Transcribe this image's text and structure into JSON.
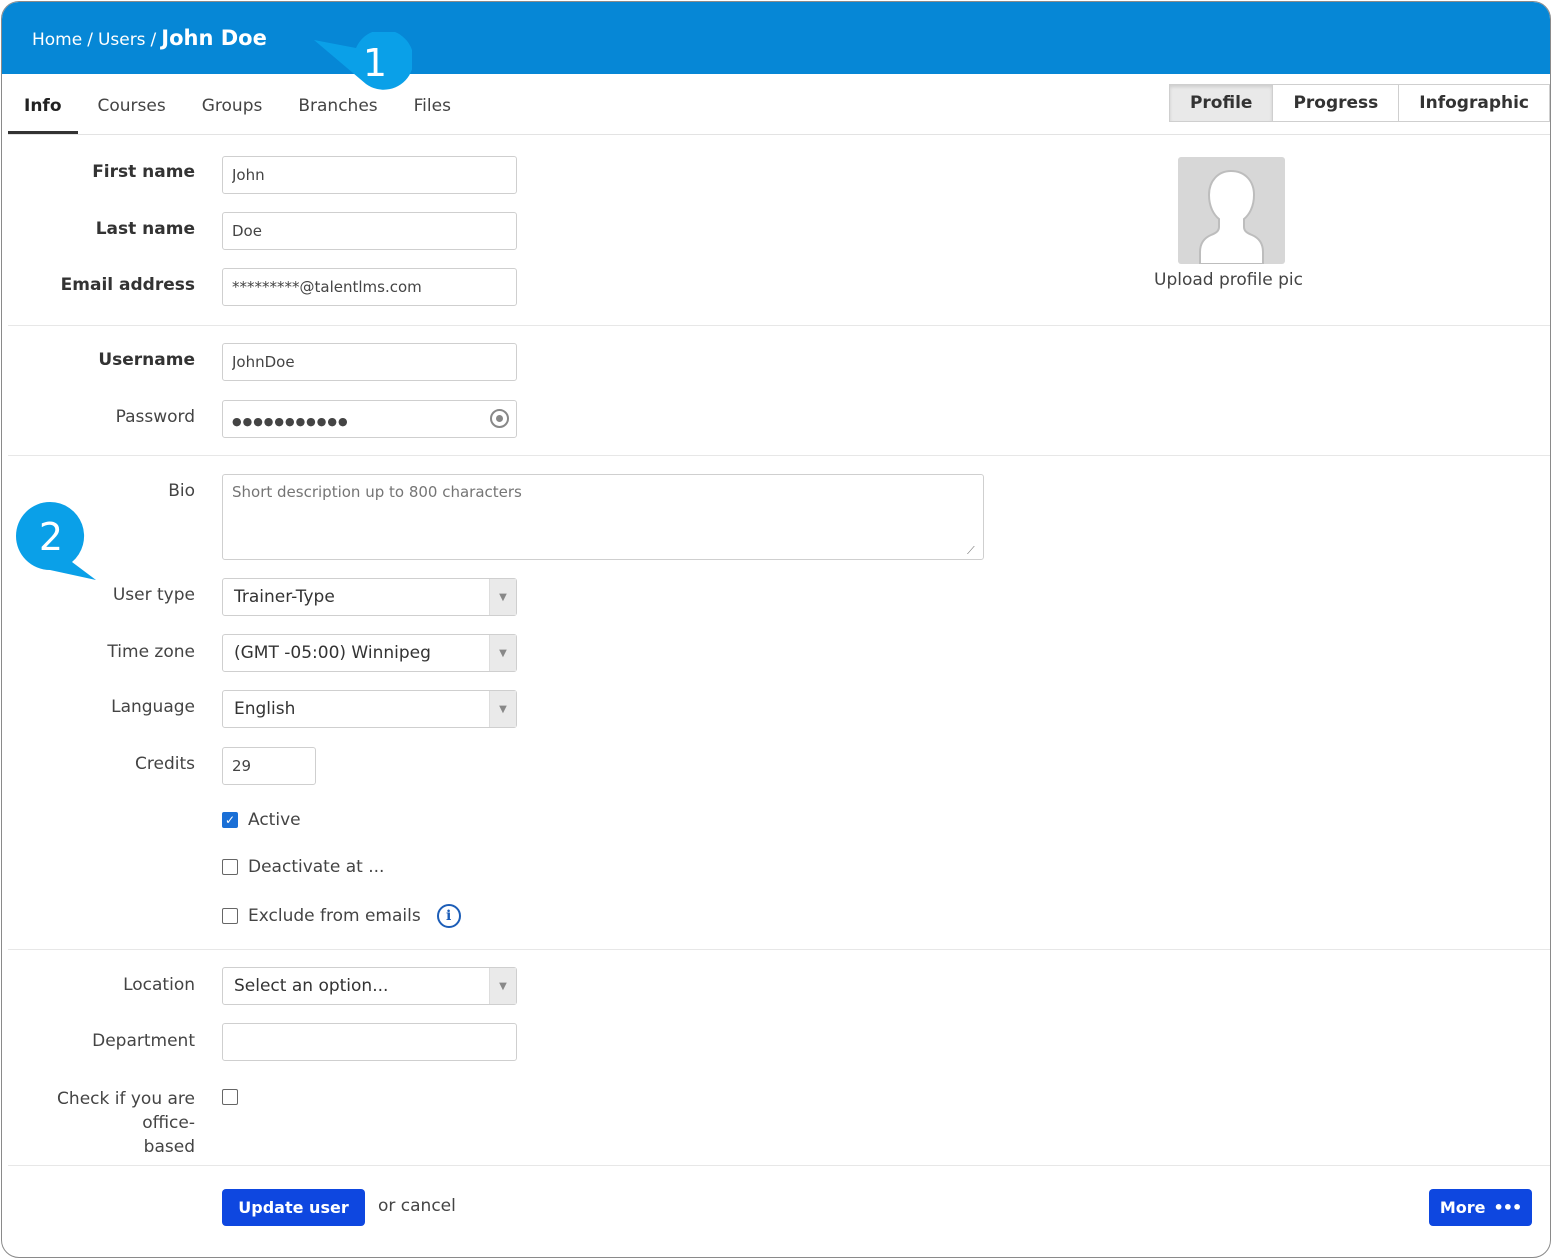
{
  "breadcrumb": {
    "home": "Home",
    "users": "Users",
    "current": "John Doe",
    "separator": "/"
  },
  "callouts": {
    "first": "1",
    "second": "2"
  },
  "tabs": [
    {
      "label": "Info",
      "active": true
    },
    {
      "label": "Courses",
      "active": false
    },
    {
      "label": "Groups",
      "active": false
    },
    {
      "label": "Branches",
      "active": false
    },
    {
      "label": "Files",
      "active": false
    }
  ],
  "view_toggle": [
    {
      "label": "Profile",
      "active": true
    },
    {
      "label": "Progress",
      "active": false
    },
    {
      "label": "Infographic",
      "active": false
    }
  ],
  "form": {
    "first_name": {
      "label": "First name",
      "value": "John"
    },
    "last_name": {
      "label": "Last name",
      "value": "Doe"
    },
    "email": {
      "label": "Email address",
      "value": "*********@talentlms.com"
    },
    "username": {
      "label": "Username",
      "value": "JohnDoe"
    },
    "password": {
      "label": "Password",
      "value": "●●●●●●●●●●●"
    },
    "bio": {
      "label": "Bio",
      "placeholder": "Short description up to 800 characters"
    },
    "user_type": {
      "label": "User type",
      "value": "Trainer-Type"
    },
    "time_zone": {
      "label": "Time zone",
      "value": "(GMT -05:00) Winnipeg"
    },
    "language": {
      "label": "Language",
      "value": "English"
    },
    "credits": {
      "label": "Credits",
      "value": "29"
    },
    "active": {
      "label": "Active",
      "checked": true
    },
    "deactivate": {
      "label": "Deactivate at ...",
      "checked": false
    },
    "exclude_emails": {
      "label": "Exclude from emails",
      "checked": false
    },
    "location": {
      "label": "Location",
      "value": "Select an option..."
    },
    "department": {
      "label": "Department",
      "value": ""
    },
    "office_based": {
      "label_line1": "Check if you are office-",
      "label_line2": "based",
      "checked": false
    }
  },
  "avatar": {
    "label": "Upload profile pic"
  },
  "actions": {
    "update": "Update user",
    "or": "or",
    "cancel": "cancel",
    "more": "More"
  },
  "colors": {
    "header": "#0687d6",
    "callout": "#0aa0e8",
    "primary_button": "#0e47e0"
  }
}
